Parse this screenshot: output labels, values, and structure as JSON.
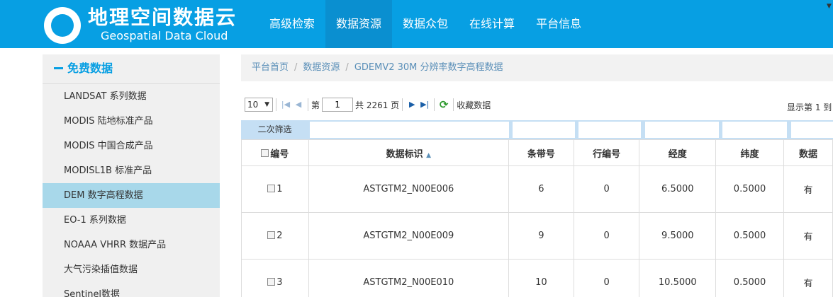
{
  "header": {
    "logo_cn": "地理空间数据云",
    "logo_en": "Geospatial Data Cloud",
    "nav": [
      "高级检索",
      "数据资源",
      "数据众包",
      "在线计算",
      "平台信息"
    ],
    "active_nav": "数据资源",
    "bg_color": "#079fe3"
  },
  "sidebar": {
    "heading": "免费数据",
    "items": [
      "LANDSAT 系列数据",
      "MODIS 陆地标准产品",
      "MODIS 中国合成产品",
      "MODISL1B 标准产品",
      "DEM 数字高程数据",
      "EO-1 系列数据",
      "NOAAA VHRR 数据产品",
      "大气污染插值数据",
      "Sentinel数据"
    ],
    "active_item": "DEM 数字高程数据"
  },
  "breadcrumb": [
    "平台首页",
    "数据资源",
    "GDEMV2 30M 分辨率数字高程数据"
  ],
  "toolbar": {
    "page_size": "10",
    "page_prefix": "第",
    "current_page": "1",
    "page_total": "共 2261 页",
    "favorite": "收藏数据",
    "showing": "显示第 1 到"
  },
  "filter": {
    "label": "二次筛选"
  },
  "table": {
    "columns": [
      "编号",
      "数据标识",
      "条带号",
      "行编号",
      "经度",
      "纬度",
      "数据"
    ],
    "sorted_column": "数据标识",
    "rows": [
      [
        "1",
        "ASTGTM2_N00E006",
        "6",
        "0",
        "6.5000",
        "0.5000",
        "有"
      ],
      [
        "2",
        "ASTGTM2_N00E009",
        "9",
        "0",
        "9.5000",
        "0.5000",
        "有"
      ],
      [
        "3",
        "ASTGTM2_N00E010",
        "10",
        "0",
        "10.5000",
        "0.5000",
        "有"
      ]
    ]
  },
  "icons": {
    "first_page": "first-page-icon",
    "prev_page": "prev-page-icon",
    "next_page": "next-page-icon",
    "last_page": "last-page-icon",
    "refresh": "refresh-icon"
  }
}
